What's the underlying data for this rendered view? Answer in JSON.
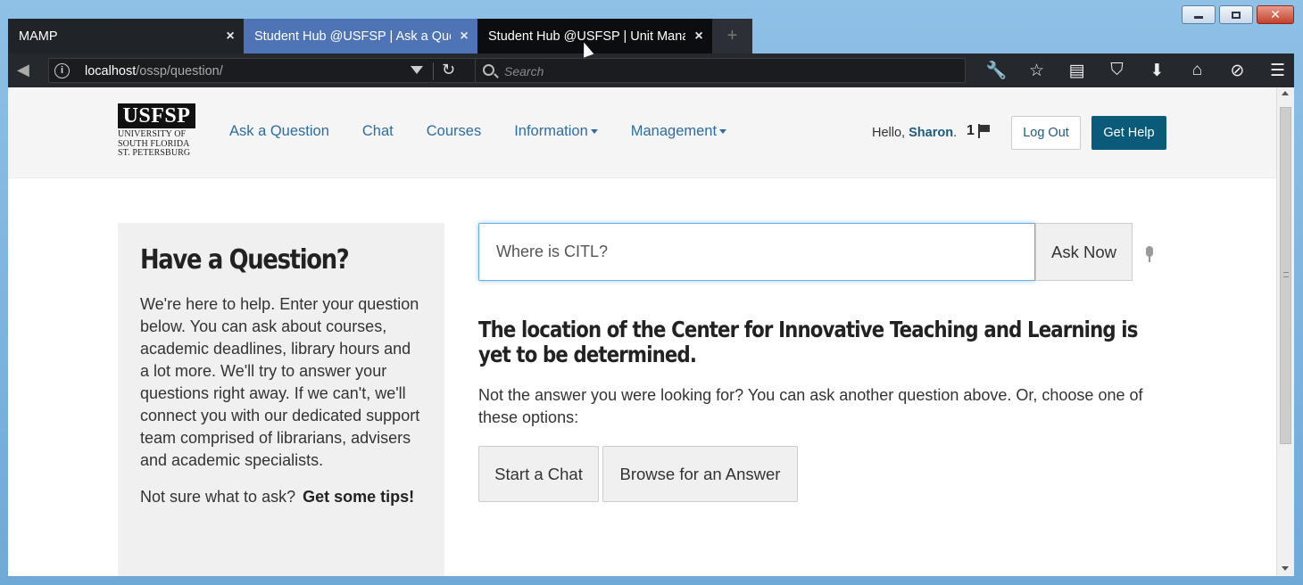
{
  "browser": {
    "tabs": [
      {
        "title": "MAMP"
      },
      {
        "title": "Student Hub @USFSP | Ask a Que"
      },
      {
        "title": "Student Hub @USFSP | Unit Mana"
      }
    ],
    "url_host": "localhost",
    "url_path": "/ossp/question/",
    "search_placeholder": "Search",
    "toolbar_icons": [
      "wrench-icon",
      "star-icon",
      "reader-icon",
      "pocket-icon",
      "download-icon",
      "home-icon",
      "sync-icon",
      "menu-icon"
    ]
  },
  "header": {
    "logo_text": "USFSP",
    "logo_sub": [
      "UNIVERSITY OF",
      "SOUTH FLORIDA",
      "ST. PETERSBURG"
    ],
    "nav": [
      "Ask a Question",
      "Chat",
      "Courses",
      "Information",
      "Management"
    ],
    "hello_prefix": "Hello,",
    "user_name": "Sharon",
    "notif_count": "1",
    "logout_label": "Log Out",
    "help_label": "Get Help"
  },
  "sidebar": {
    "title": "Have a Question?",
    "body": "We're here to help. Enter your question below. You can ask about courses, academic deadlines, library hours and a lot more. We'll try to answer your questions right away. If we can't, we'll connect you with our dedicated support team comprised of librarians, advisers and academic specialists.",
    "tips_prefix": "Not sure what to ask?",
    "tips_link": "Get some tips!"
  },
  "ask": {
    "value": "Where is CITL?",
    "button": "Ask Now"
  },
  "answer": {
    "text": "The location of the Center for Innovative Teaching and Learning is yet to be determined.",
    "followup": "Not the answer you were looking for? You can ask another question above. Or, choose one of these options:",
    "chat_button": "Start a Chat",
    "browse_button": "Browse for an Answer"
  },
  "colors": {
    "link": "#2e6da4",
    "help_button": "#0a5a7a",
    "active_tab": "#4f74b5"
  }
}
